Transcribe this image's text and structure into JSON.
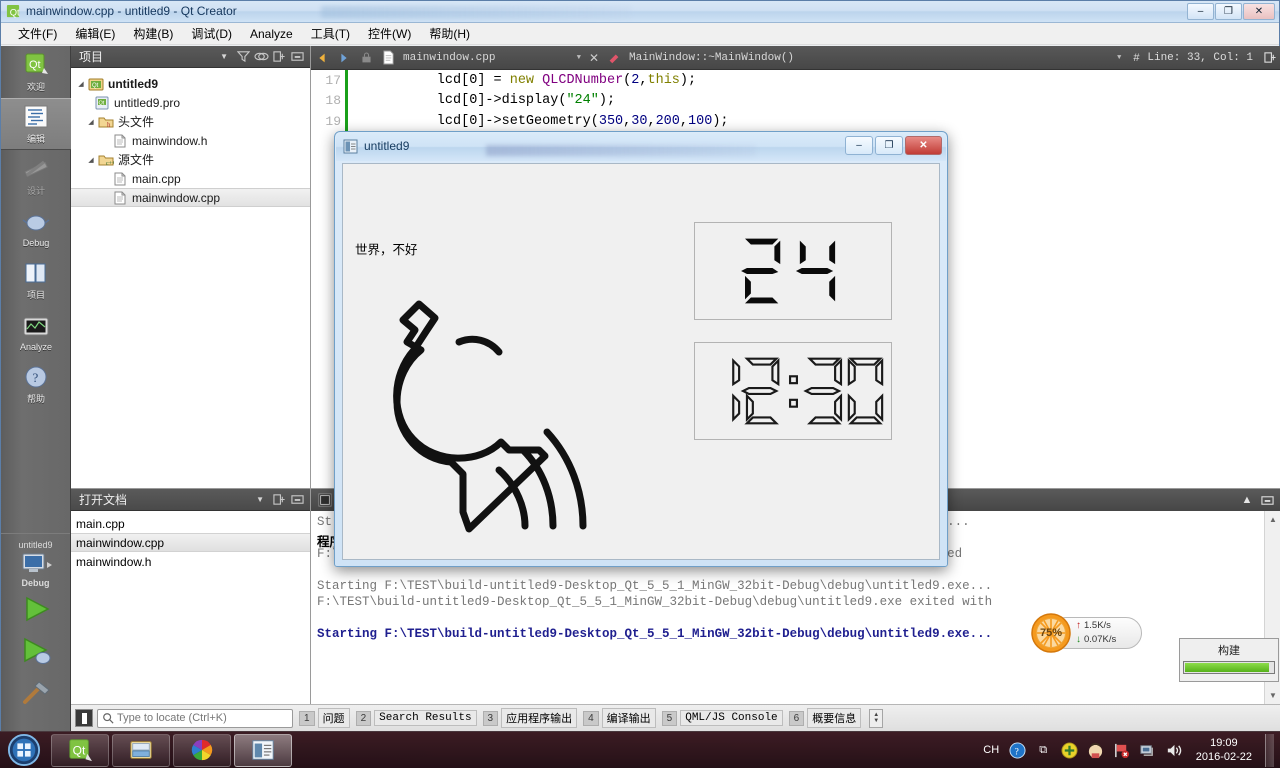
{
  "window": {
    "title": "mainwindow.cpp - untitled9 - Qt Creator",
    "icon": "qt-logo-icon",
    "controls": {
      "minimize": "–",
      "maximize": "❐",
      "close": "✕"
    }
  },
  "menubar": {
    "items": [
      {
        "label": "文件(F)",
        "name": "menu-file"
      },
      {
        "label": "编辑(E)",
        "name": "menu-edit"
      },
      {
        "label": "构建(B)",
        "name": "menu-build"
      },
      {
        "label": "调试(D)",
        "name": "menu-debug"
      },
      {
        "label": "Analyze",
        "name": "menu-analyze"
      },
      {
        "label": "工具(T)",
        "name": "menu-tools"
      },
      {
        "label": "控件(W)",
        "name": "menu-window"
      },
      {
        "label": "帮助(H)",
        "name": "menu-help"
      }
    ]
  },
  "modebar": {
    "modes": [
      {
        "label": "欢迎",
        "name": "mode-welcome",
        "active": false
      },
      {
        "label": "编辑",
        "name": "mode-edit",
        "active": true
      },
      {
        "label": "设计",
        "name": "mode-design",
        "active": false,
        "disabled": true
      },
      {
        "label": "Debug",
        "name": "mode-debug",
        "active": false
      },
      {
        "label": "项目",
        "name": "mode-projects",
        "active": false
      },
      {
        "label": "Analyze",
        "name": "mode-analyze",
        "active": false
      },
      {
        "label": "帮助",
        "name": "mode-help",
        "active": false
      }
    ],
    "kit": {
      "project": "untitled9",
      "config": "Debug"
    }
  },
  "project_pane": {
    "title": "项目",
    "tree": [
      {
        "label": "untitled9",
        "icon": "project-icon",
        "depth": 0,
        "bold": true,
        "expander": true,
        "selected": false
      },
      {
        "label": "untitled9.pro",
        "icon": "pro-file-icon",
        "depth": 1,
        "bold": false,
        "expander": false,
        "selected": false
      },
      {
        "label": "头文件",
        "icon": "header-folder-icon",
        "depth": 1,
        "bold": false,
        "expander": true,
        "selected": false
      },
      {
        "label": "mainwindow.h",
        "icon": "file-icon",
        "depth": 2,
        "bold": false,
        "expander": false,
        "selected": false
      },
      {
        "label": "源文件",
        "icon": "source-folder-icon",
        "depth": 1,
        "bold": false,
        "expander": true,
        "selected": false
      },
      {
        "label": "main.cpp",
        "icon": "file-icon",
        "depth": 2,
        "bold": false,
        "expander": false,
        "selected": false
      },
      {
        "label": "mainwindow.cpp",
        "icon": "file-icon",
        "depth": 2,
        "bold": false,
        "expander": false,
        "selected": true
      }
    ]
  },
  "documents_pane": {
    "title": "打开文档",
    "items": [
      {
        "label": "main.cpp",
        "selected": false
      },
      {
        "label": "mainwindow.cpp",
        "selected": true
      },
      {
        "label": "mainwindow.h",
        "selected": false
      }
    ]
  },
  "editor": {
    "file_combo": "mainwindow.cpp",
    "symbol_combo": "MainWindow::~MainWindow()",
    "line_col": "Line: 33, Col: 1",
    "close_label": "✕",
    "lines": [
      {
        "number": "17",
        "tokens": [
          {
            "t": "        lcd[0] = ",
            "c": ""
          },
          {
            "t": "new",
            "c": "kw"
          },
          {
            "t": " ",
            "c": ""
          },
          {
            "t": "QLCDNumber",
            "c": "cls"
          },
          {
            "t": "(",
            "c": ""
          },
          {
            "t": "2",
            "c": "num"
          },
          {
            "t": ",",
            "c": ""
          },
          {
            "t": "this",
            "c": "kw"
          },
          {
            "t": ");",
            "c": ""
          }
        ]
      },
      {
        "number": "18",
        "tokens": [
          {
            "t": "        lcd[0]->display(",
            "c": ""
          },
          {
            "t": "\"24\"",
            "c": "str"
          },
          {
            "t": ");",
            "c": ""
          }
        ]
      },
      {
        "number": "19",
        "tokens": [
          {
            "t": "        lcd[0]->setGeometry(",
            "c": ""
          },
          {
            "t": "350",
            "c": "num"
          },
          {
            "t": ",",
            "c": ""
          },
          {
            "t": "30",
            "c": "num"
          },
          {
            "t": ",",
            "c": ""
          },
          {
            "t": "200",
            "c": "num"
          },
          {
            "t": ",",
            "c": ""
          },
          {
            "t": "100",
            "c": "num"
          },
          {
            "t": ");",
            "c": ""
          }
        ]
      }
    ]
  },
  "output_pane": {
    "lines": [
      {
        "text": "St                                                                          led9.exe...",
        "style": ""
      },
      {
        "text": "程序异常结束。",
        "style": "err"
      },
      {
        "text": "F:\\TEST\\build-untitled9-Desktop_Qt_5_5_1_MinGW_32bit-Debug\\debug\\untitled9.exe crashed",
        "style": ""
      },
      {
        "text": "",
        "style": ""
      },
      {
        "text": "Starting F:\\TEST\\build-untitled9-Desktop_Qt_5_5_1_MinGW_32bit-Debug\\debug\\untitled9.exe...",
        "style": ""
      },
      {
        "text": "F:\\TEST\\build-untitled9-Desktop_Qt_5_5_1_MinGW_32bit-Debug\\debug\\untitled9.exe exited with",
        "style": ""
      },
      {
        "text": "",
        "style": ""
      },
      {
        "text": "Starting F:\\TEST\\build-untitled9-Desktop_Qt_5_5_1_MinGW_32bit-Debug\\debug\\untitled9.exe...",
        "style": "start"
      }
    ]
  },
  "build_toast": {
    "label": "构建",
    "progress": 95
  },
  "statusbar": {
    "locator_placeholder": "Type to locate (Ctrl+K)",
    "buttons": [
      {
        "n": "1",
        "label": "问题",
        "active": true
      },
      {
        "n": "2",
        "label": "Search Results",
        "active": true
      },
      {
        "n": "3",
        "label": "应用程序输出",
        "active": true
      },
      {
        "n": "4",
        "label": "编译输出",
        "active": true
      },
      {
        "n": "5",
        "label": "QML/JS Console",
        "active": true
      },
      {
        "n": "6",
        "label": "概要信息",
        "active": true
      }
    ]
  },
  "app_window": {
    "title": "untitled9",
    "icon": "app-window-icon",
    "controls": {
      "minimize": "–",
      "maximize": "❐",
      "close": "✕"
    },
    "label_text": "世界，不好",
    "lcd_primary": "24",
    "lcd_secondary": "12:30",
    "drawing": "hand-drawn-comet-figure"
  },
  "net_widget": {
    "percent": "75%",
    "upload": "1.5K/s",
    "download": "0.07K/s",
    "up_arrow": "↑",
    "down_arrow": "↓"
  },
  "taskbar": {
    "buttons": [
      {
        "name": "taskbar-qt-creator",
        "icon": "qt-logo-icon",
        "active": false
      },
      {
        "name": "taskbar-explorer",
        "icon": "folder-icon",
        "active": false
      },
      {
        "name": "taskbar-colorwheel",
        "icon": "color-wheel-icon",
        "active": false
      },
      {
        "name": "taskbar-untitled9-app",
        "icon": "app-window-icon",
        "active": true
      }
    ],
    "tray": [
      {
        "name": "tray-ime",
        "glyph": "CH"
      },
      {
        "name": "tray-help-icon",
        "glyph": "?"
      },
      {
        "name": "tray-overflow-icon",
        "glyph": "⧉"
      },
      {
        "name": "tray-plus-icon",
        "glyph": "+"
      },
      {
        "name": "tray-qq-icon",
        "glyph": "●"
      },
      {
        "name": "tray-flag-icon",
        "glyph": "⚑"
      },
      {
        "name": "tray-network-icon",
        "glyph": "▣"
      },
      {
        "name": "tray-volume-icon",
        "glyph": "◂)"
      }
    ],
    "clock": {
      "time": "19:09",
      "date": "2016-02-22"
    }
  }
}
